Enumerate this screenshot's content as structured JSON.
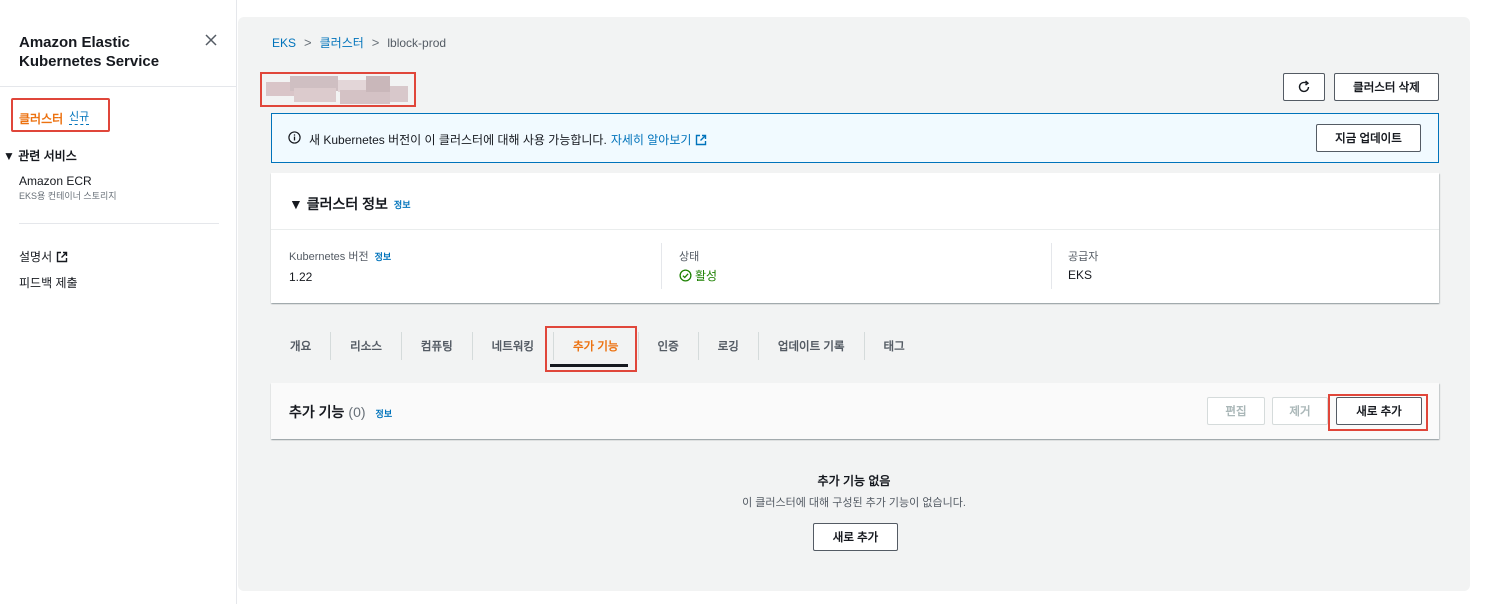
{
  "sidebar": {
    "title": "Amazon Elastic Kubernetes Service",
    "active_item": "클러스터",
    "new_badge": "신규",
    "section_label": "▼ 관련 서비스",
    "ecr_label": "Amazon ECR",
    "ecr_sub": "EKS용 컨테이너 스토리지",
    "docs_label": "설명서",
    "feedback_label": "피드백 제출"
  },
  "breadcrumb": [
    "EKS",
    "클러스터",
    "lblock-prod"
  ],
  "header": {
    "refresh_icon": "refresh-icon",
    "delete_label": "클러스터 삭제"
  },
  "alert": {
    "text": "새 Kubernetes 버전이 이 클러스터에 대해 사용 가능합니다.",
    "link": "자세히 알아보기",
    "button": "지금 업데이트"
  },
  "cluster_info": {
    "title": "▼ 클러스터 정보",
    "info": "정보",
    "columns": [
      {
        "label": "Kubernetes 버전",
        "info": "정보",
        "value": "1.22"
      },
      {
        "label": "상태",
        "value": "활성"
      },
      {
        "label": "공급자",
        "value": "EKS"
      }
    ],
    "status_color": "#1d8102"
  },
  "tabs": [
    {
      "label": "개요",
      "active": false
    },
    {
      "label": "리소스",
      "active": false
    },
    {
      "label": "컴퓨팅",
      "active": false
    },
    {
      "label": "네트워킹",
      "active": false
    },
    {
      "label": "추가 기능",
      "active": true
    },
    {
      "label": "인증",
      "active": false
    },
    {
      "label": "로깅",
      "active": false
    },
    {
      "label": "업데이트 기록",
      "active": false
    },
    {
      "label": "태그",
      "active": false
    }
  ],
  "addons": {
    "title": "추가 기능",
    "count": "(0)",
    "info": "정보",
    "edit_label": "편집",
    "remove_label": "제거",
    "add_label": "새로 추가",
    "empty_title": "추가 기능 없음",
    "empty_desc": "이 클러스터에 대해 구성된 추가 기능이 없습니다.",
    "empty_add_label": "새로 추가"
  },
  "colors": {
    "accent": "#ec7211",
    "link": "#0073bb",
    "highlight": "#e0463a"
  }
}
